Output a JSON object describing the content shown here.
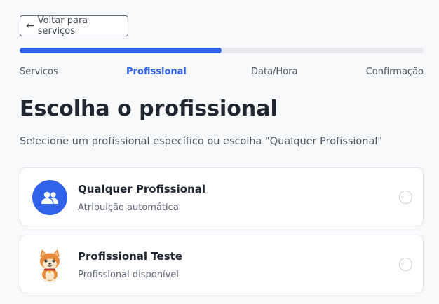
{
  "back_button": {
    "label": "Voltar para serviços",
    "icon": "arrow-left-icon"
  },
  "progress": {
    "fraction": 0.5,
    "color": "#2f62e9"
  },
  "steps": [
    {
      "label": "Serviços",
      "active": false
    },
    {
      "label": "Profissional",
      "active": true
    },
    {
      "label": "Data/Hora",
      "active": false
    },
    {
      "label": "Confirmação",
      "active": false
    }
  ],
  "page": {
    "title": "Escolha o profissional",
    "subtitle": "Selecione um profissional específico ou escolha \"Qualquer Profissional\""
  },
  "options": [
    {
      "name": "Qualquer Profissional",
      "description": "Atribuição automática",
      "icon": "users-icon",
      "selected": false
    },
    {
      "name": "Profissional Teste",
      "description": "Profissional disponível",
      "icon": "shiba-dog-avatar",
      "selected": false
    }
  ],
  "colors": {
    "accent": "#2f62e9",
    "background": "#f8f9fb"
  }
}
